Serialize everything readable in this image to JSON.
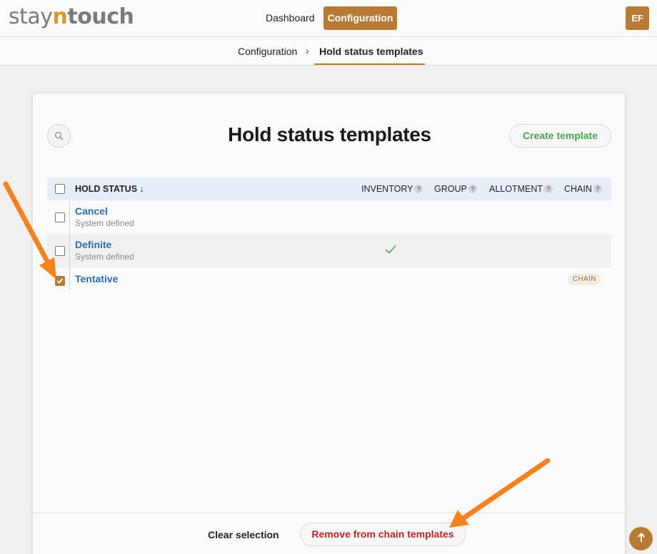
{
  "header": {
    "logo_stay": "stay",
    "logo_n": "n",
    "logo_touch": "touch",
    "nav": {
      "dashboard": "Dashboard",
      "configuration": "Configuration"
    },
    "avatar_initials": "EF"
  },
  "breadcrumb": {
    "parent": "Configuration",
    "separator": "›",
    "current": "Hold status templates"
  },
  "page": {
    "title": "Hold status templates",
    "create_button": "Create template",
    "search_icon": "search-icon"
  },
  "table": {
    "columns": {
      "hold_status": "HOLD STATUS",
      "sort_arrow": "↓",
      "inventory": "INVENTORY",
      "group": "GROUP",
      "allotment": "ALLOTMENT",
      "chain": "CHAIN",
      "help": "?"
    },
    "rows": [
      {
        "name": "Cancel",
        "subtitle": "System defined",
        "selected": false,
        "inventory": false,
        "chain": false
      },
      {
        "name": "Definite",
        "subtitle": "System defined",
        "selected": false,
        "inventory": true,
        "chain": false
      },
      {
        "name": "Tentative",
        "subtitle": "",
        "selected": true,
        "inventory": false,
        "chain": true,
        "chain_badge": "CHAIN"
      }
    ]
  },
  "footer": {
    "clear_selection": "Clear selection",
    "remove_button": "Remove from chain templates"
  },
  "colors": {
    "brand": "#b87b35",
    "link": "#2b6cb0",
    "create": "#4aa24a",
    "danger": "#b3261e",
    "annotation_arrow": "#f5821f"
  }
}
